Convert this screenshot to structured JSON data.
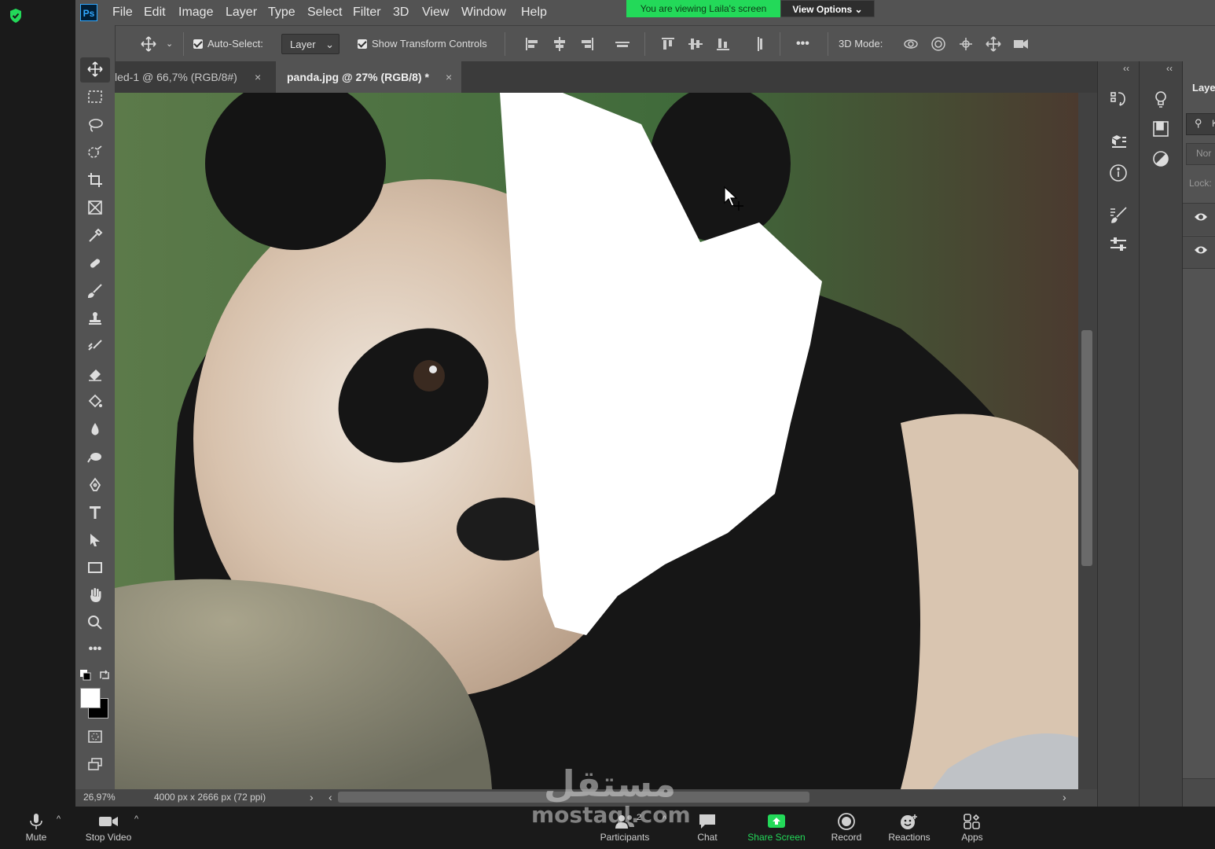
{
  "zoom": {
    "viewing_banner": "You are viewing Laila's screen",
    "view_options": "View Options",
    "bottom_bar": [
      {
        "label": "Mute",
        "icon": "microphone-icon"
      },
      {
        "label": "Stop Video",
        "icon": "video-camera-icon"
      },
      {
        "label": "Participants",
        "icon": "participants-icon",
        "count": "2"
      },
      {
        "label": "Chat",
        "icon": "chat-icon"
      },
      {
        "label": "Share Screen",
        "icon": "share-screen-icon"
      },
      {
        "label": "Record",
        "icon": "record-icon"
      },
      {
        "label": "Reactions",
        "icon": "reactions-icon"
      },
      {
        "label": "Apps",
        "icon": "apps-icon"
      }
    ],
    "colors": {
      "green": "#23d959",
      "dark": "#1a1a1a"
    }
  },
  "photoshop": {
    "logo": "Ps",
    "menu": [
      "File",
      "Edit",
      "Image",
      "Layer",
      "Type",
      "Select",
      "Filter",
      "3D",
      "View",
      "Window",
      "Help"
    ],
    "options": {
      "auto_select": "Auto-Select:",
      "layer_dropdown": "Layer",
      "show_transform": "Show Transform Controls",
      "more": "•••",
      "mode_3d": "3D Mode:"
    },
    "tabs": [
      {
        "label": "led-1 @ 66,7% (RGB/8#)",
        "close": "×"
      },
      {
        "label": "panda.jpg @ 27% (RGB/8) *",
        "close": "×"
      }
    ],
    "status": {
      "zoom": "26,97%",
      "dimensions": "4000 px x 2666 px (72 ppi)",
      "arrow": "›",
      "left_arrow": "‹",
      "right_arrow": "›"
    },
    "toolbox_more": "•••",
    "layers_panel": {
      "title": "Laye",
      "search": "K",
      "blend": "Nor",
      "lock": "Lock:"
    },
    "collapse": "‹‹",
    "collapse_toolbox": "››",
    "close_toolbox": "×"
  },
  "watermark": {
    "arabic": "مستقل",
    "latin": "mostaql.com"
  }
}
